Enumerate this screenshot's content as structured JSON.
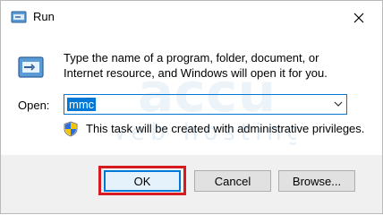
{
  "window": {
    "title": "Run"
  },
  "content": {
    "description": "Type the name of a program, folder, document, or Internet resource, and Windows will open it for you.",
    "open_label": "Open:",
    "open_value": "mmc",
    "admin_notice": "This task will be created with administrative privileges."
  },
  "buttons": {
    "ok": "OK",
    "cancel": "Cancel",
    "browse": "Browse..."
  },
  "watermark": {
    "line1": "accu",
    "line2": "web hosting"
  },
  "colors": {
    "accent": "#0078d7",
    "highlight_box": "#d71920"
  },
  "icons": {
    "title": "run-app-icon",
    "close": "close-icon",
    "run": "run-dialog-icon",
    "dropdown": "chevron-down-icon",
    "shield": "uac-shield-icon"
  }
}
